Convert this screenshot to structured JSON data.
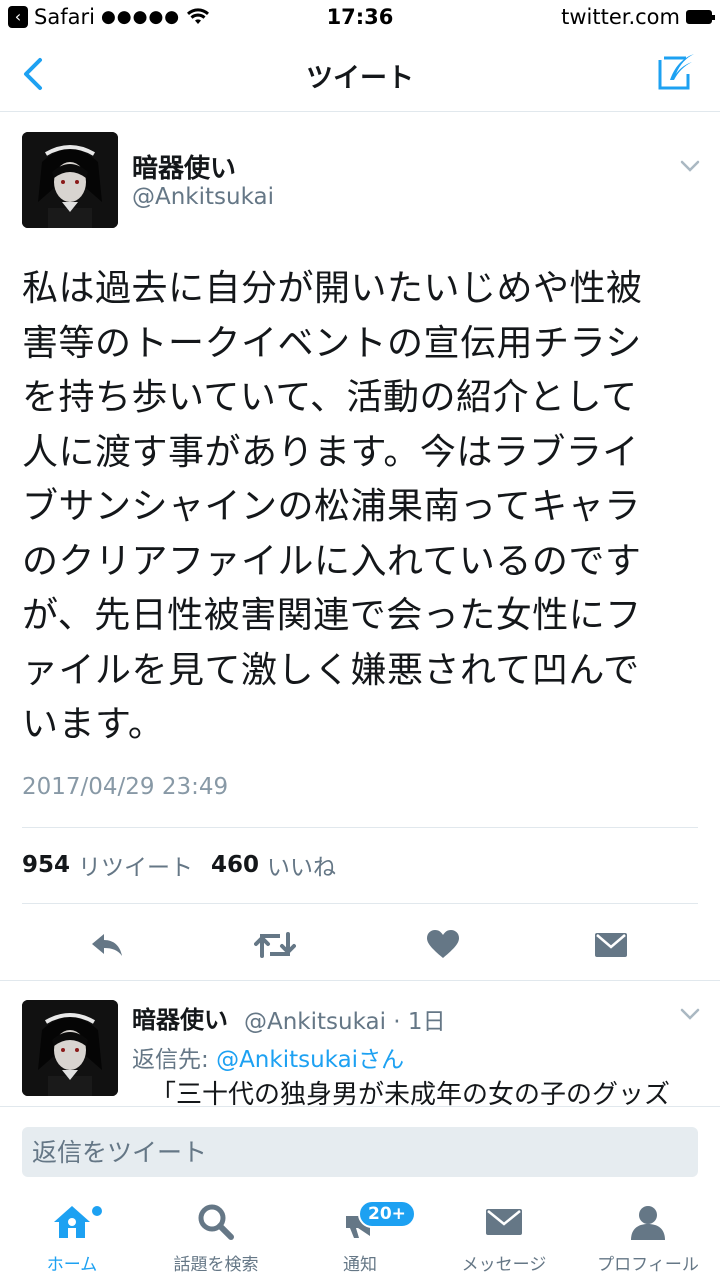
{
  "status_bar": {
    "back_app": "Safari",
    "signal": "●●●●●",
    "time": "17:36",
    "url": "twitter.com"
  },
  "nav": {
    "title": "ツイート"
  },
  "tweet": {
    "author_name": "暗器使い",
    "author_handle": "@Ankitsukai",
    "text_lines": [
      "私は過去に自分が開いたいじめや性被",
      "害等のトークイベントの宣伝用チラシ",
      "を持ち歩いていて、活動の紹介として",
      "人に渡す事があります。今はラブライ",
      "ブサンシャインの松浦果南ってキャラ",
      "のクリアファイルに入れているのです",
      "が、先日性被害関連で会った女性にフ",
      "ァイルを見て激しく嫌悪されて凹んで",
      "います。"
    ],
    "timestamp": "2017/04/29 23:49",
    "retweet_count": "954",
    "retweet_label": "リツイート",
    "like_count": "460",
    "like_label": "いいね"
  },
  "reply": {
    "author_name": "暗器使い",
    "author_handle": "@Ankitsukai · 1日",
    "reply_to_prefix": "返信先: ",
    "reply_to_link": "@Ankitsukai",
    "reply_to_suffix": "さん",
    "text": "「三十代の独身男が未成年の女の子のグッズ"
  },
  "reply_box": {
    "placeholder": "返信をツイート"
  },
  "tabs": [
    {
      "label": "ホーム",
      "icon": "home-icon",
      "active": true
    },
    {
      "label": "話題を検索",
      "icon": "search-icon"
    },
    {
      "label": "通知",
      "icon": "notifications-icon",
      "badge": "20+"
    },
    {
      "label": "メッセージ",
      "icon": "messages-icon"
    },
    {
      "label": "プロフィール",
      "icon": "profile-icon"
    }
  ],
  "colors": {
    "accent": "#1da1f2",
    "text": "#14171a",
    "secondary": "#657786",
    "icon_gray": "#657786"
  }
}
